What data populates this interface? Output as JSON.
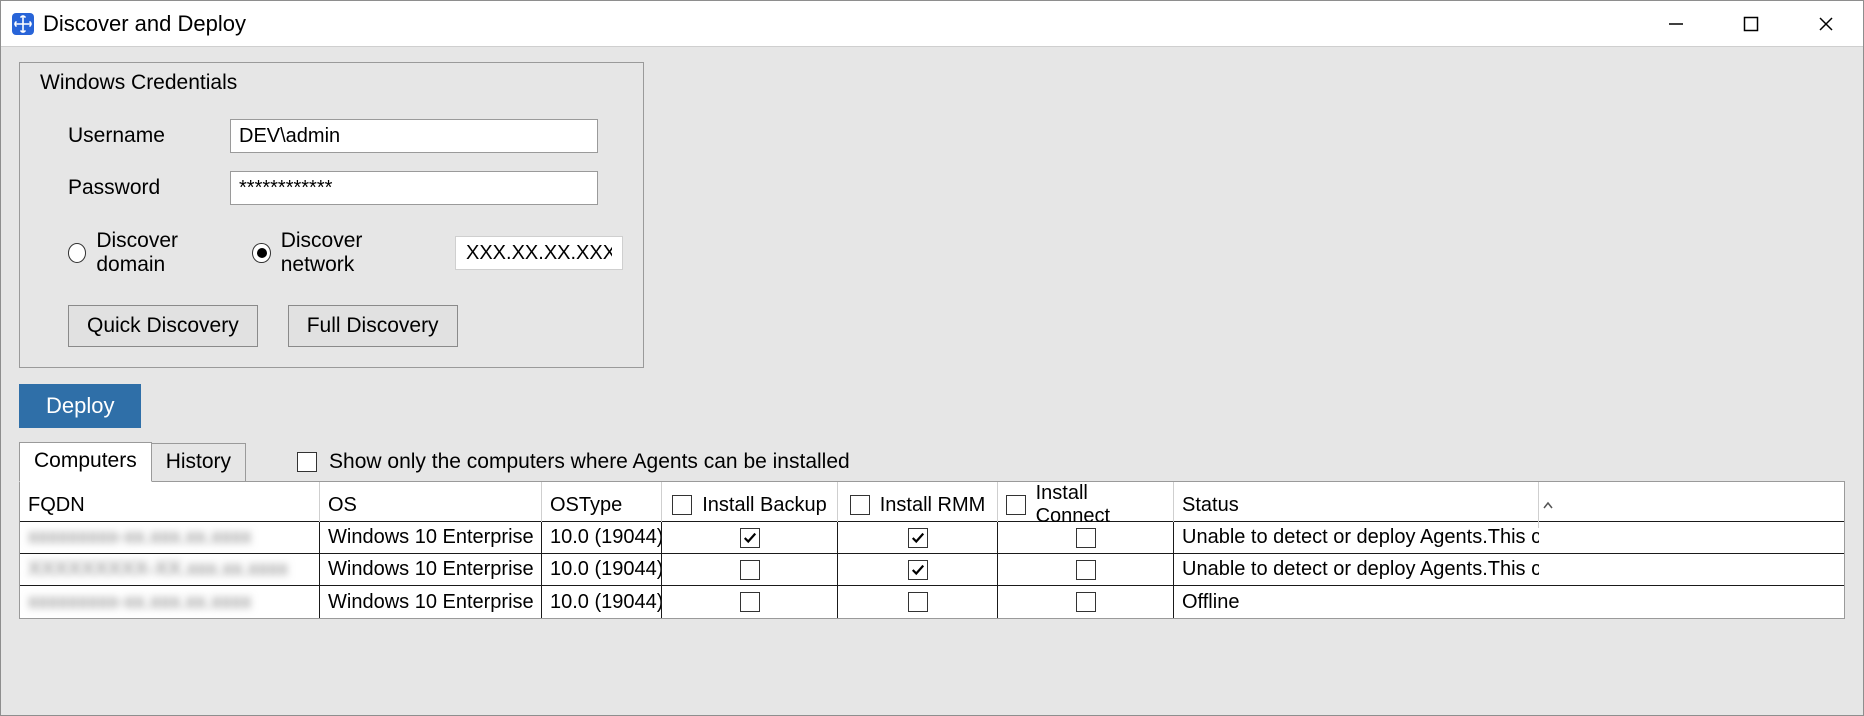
{
  "window": {
    "title": "Discover and Deploy"
  },
  "credentials": {
    "legend": "Windows Credentials",
    "username_label": "Username",
    "username_value": "DEV\\admin",
    "password_label": "Password",
    "password_value": "************",
    "discover_domain_label": "Discover domain",
    "discover_network_label": "Discover network",
    "network_value": "XXX.XX.XX.XXX",
    "quick_btn": "Quick Discovery",
    "full_btn": "Full Discovery"
  },
  "deploy_btn": "Deploy",
  "tabs": {
    "computers": "Computers",
    "history": "History"
  },
  "filter": {
    "label": "Show only the computers where Agents can be installed"
  },
  "table": {
    "headers": {
      "fqdn": "FQDN",
      "os": "OS",
      "ostype": "OSType",
      "install_backup": "Install Backup",
      "install_rmm": "Install RMM",
      "install_connect": "Install Connect",
      "status": "Status"
    },
    "rows": [
      {
        "fqdn": "xxxxxxxxx-xx.xxx.xx.xxxx",
        "os": "Windows 10 Enterprise",
        "ostype": "10.0 (19044)",
        "install_backup": true,
        "install_rmm": true,
        "install_connect": false,
        "status": "Unable to detect or deploy Agents.This c"
      },
      {
        "fqdn": "XXXXXXXXX-XX.xxx.xx.xxxx",
        "os": "Windows 10 Enterprise",
        "ostype": "10.0 (19044)",
        "install_backup": false,
        "install_rmm": true,
        "install_connect": false,
        "status": "Unable to detect or deploy Agents.This c"
      },
      {
        "fqdn": "xxxxxxxxx-xx.xxx.xx.xxxx",
        "os": "Windows 10 Enterprise",
        "ostype": "10.0 (19044)",
        "install_backup": false,
        "install_rmm": false,
        "install_connect": false,
        "status": "Offline"
      }
    ]
  }
}
